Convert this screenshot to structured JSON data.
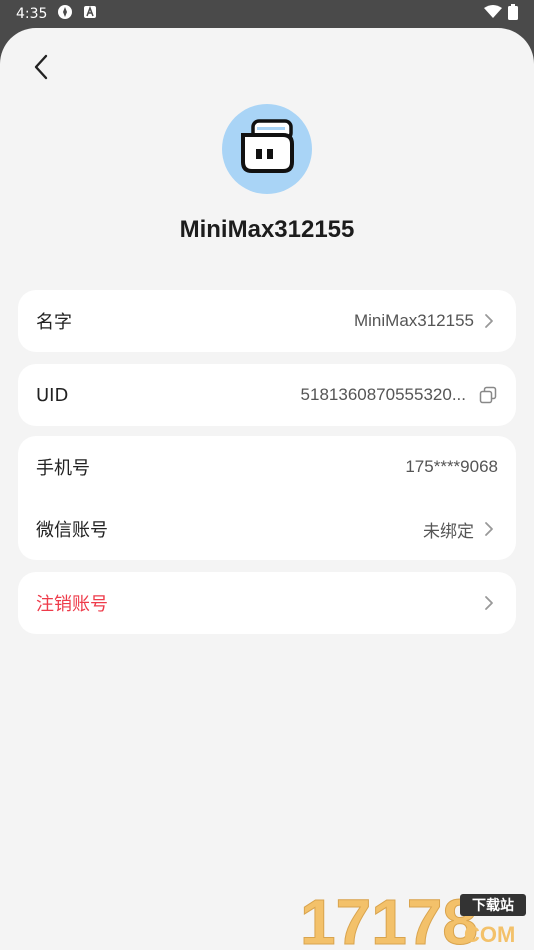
{
  "status_bar": {
    "time": "4:35"
  },
  "profile": {
    "username": "MiniMax312155"
  },
  "rows": {
    "name": {
      "label": "名字",
      "value": "MiniMax312155"
    },
    "uid": {
      "label": "UID",
      "value": "5181360870555320..."
    },
    "phone": {
      "label": "手机号",
      "value": "175****9068"
    },
    "wechat": {
      "label": "微信账号",
      "value": "未绑定"
    },
    "delete": {
      "label": "注销账号"
    }
  },
  "watermark": {
    "number": "17178",
    "badge": "下载站",
    "suffix": "COM"
  },
  "colors": {
    "accent_danger": "#ee3b4a",
    "avatar_bg": "#a9d4f6",
    "page_bg": "#f4f4f4"
  }
}
